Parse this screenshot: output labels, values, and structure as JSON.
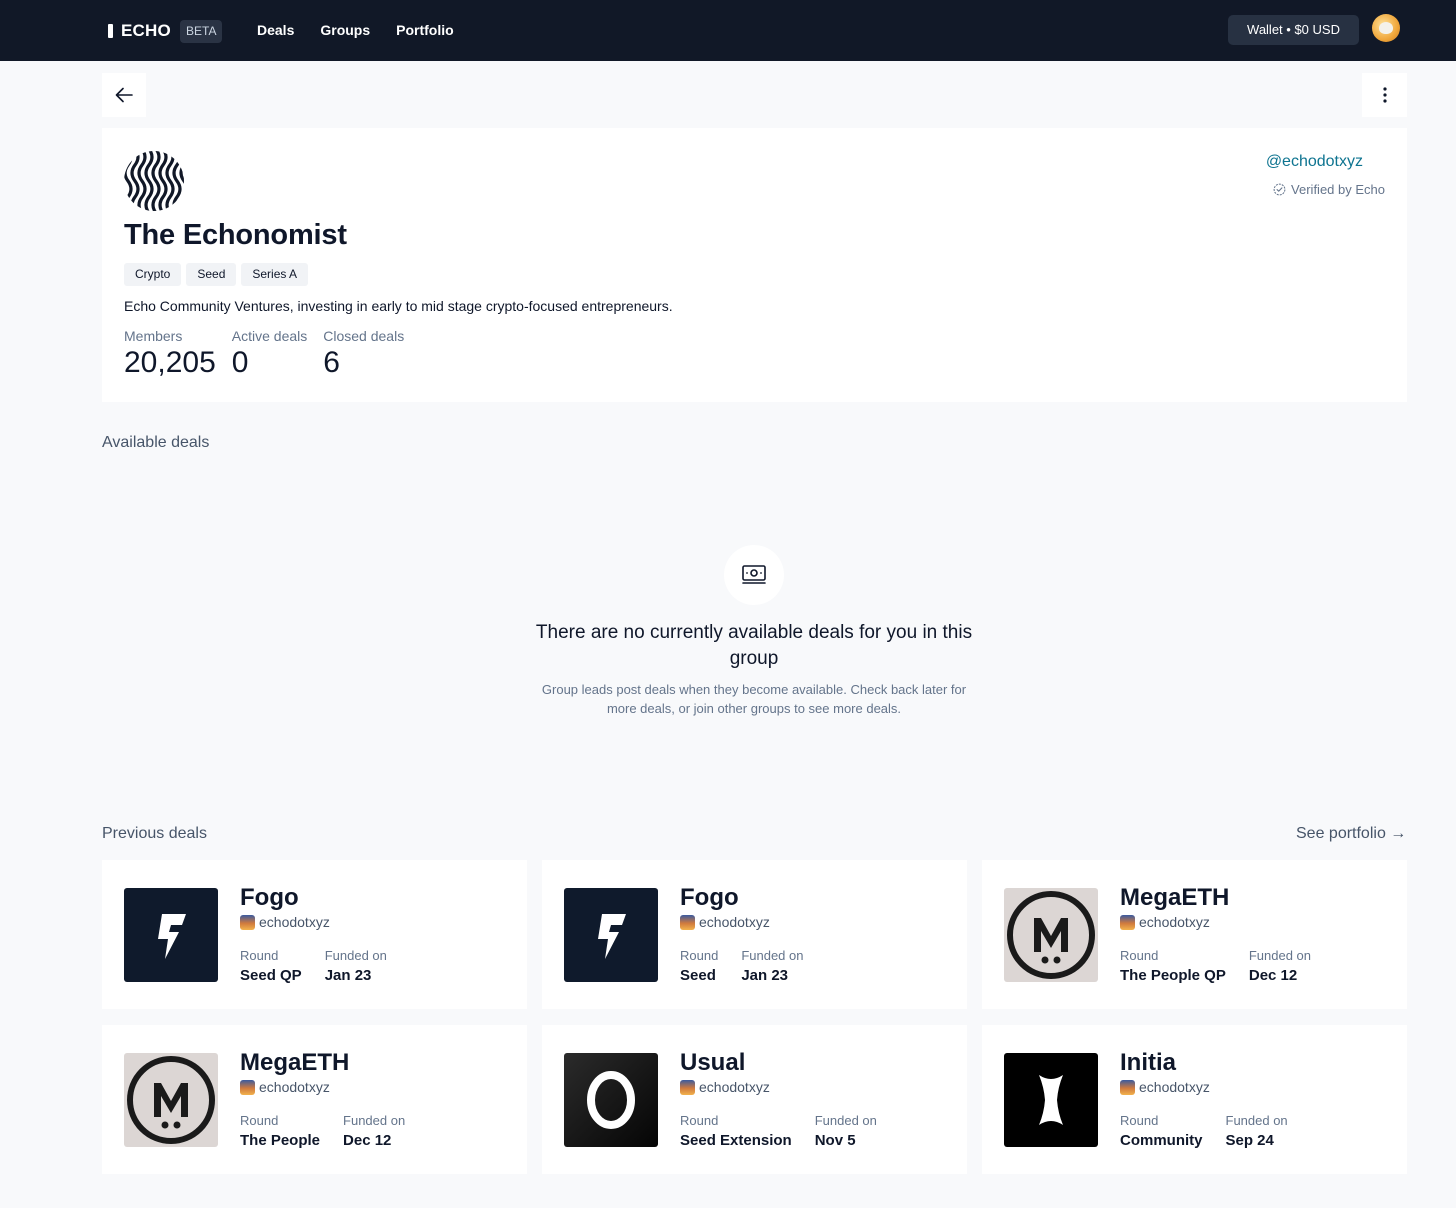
{
  "header": {
    "logo": "ECHO",
    "badge": "BETA",
    "nav": [
      "Deals",
      "Groups",
      "Portfolio"
    ],
    "wallet": "Wallet • $0 USD"
  },
  "group": {
    "name": "The Echonomist",
    "tags": [
      "Crypto",
      "Seed",
      "Series A"
    ],
    "description": "Echo Community Ventures, investing in early to mid stage crypto-focused entrepreneurs.",
    "stats": [
      {
        "label": "Members",
        "value": "20,205"
      },
      {
        "label": "Active deals",
        "value": "0"
      },
      {
        "label": "Closed deals",
        "value": "6"
      }
    ],
    "handle": "@echodotxyz",
    "verified": "Verified by Echo"
  },
  "available": {
    "title": "Available deals",
    "empty_title": "There are no currently available deals for you in this group",
    "empty_sub": "Group leads post deals when they become available. Check back later for more deals, or join other groups to see more deals."
  },
  "previous": {
    "title": "Previous deals",
    "see_portfolio": "See portfolio →",
    "round_label": "Round",
    "funded_label": "Funded on",
    "deals": [
      {
        "name": "Fogo",
        "owner": "echodotxyz",
        "round": "Seed QP",
        "funded": "Jan 23",
        "logo": "fogo"
      },
      {
        "name": "Fogo",
        "owner": "echodotxyz",
        "round": "Seed",
        "funded": "Jan 23",
        "logo": "fogo"
      },
      {
        "name": "MegaETH",
        "owner": "echodotxyz",
        "round": "The People QP",
        "funded": "Dec 12",
        "logo": "megaeth"
      },
      {
        "name": "MegaETH",
        "owner": "echodotxyz",
        "round": "The People",
        "funded": "Dec 12",
        "logo": "megaeth"
      },
      {
        "name": "Usual",
        "owner": "echodotxyz",
        "round": "Seed Extension",
        "funded": "Nov 5",
        "logo": "usual"
      },
      {
        "name": "Initia",
        "owner": "echodotxyz",
        "round": "Community",
        "funded": "Sep 24",
        "logo": "initia"
      }
    ]
  },
  "colors": {
    "topbar": "#111827",
    "accent": "#0e7490",
    "background": "#f8f9fb"
  }
}
